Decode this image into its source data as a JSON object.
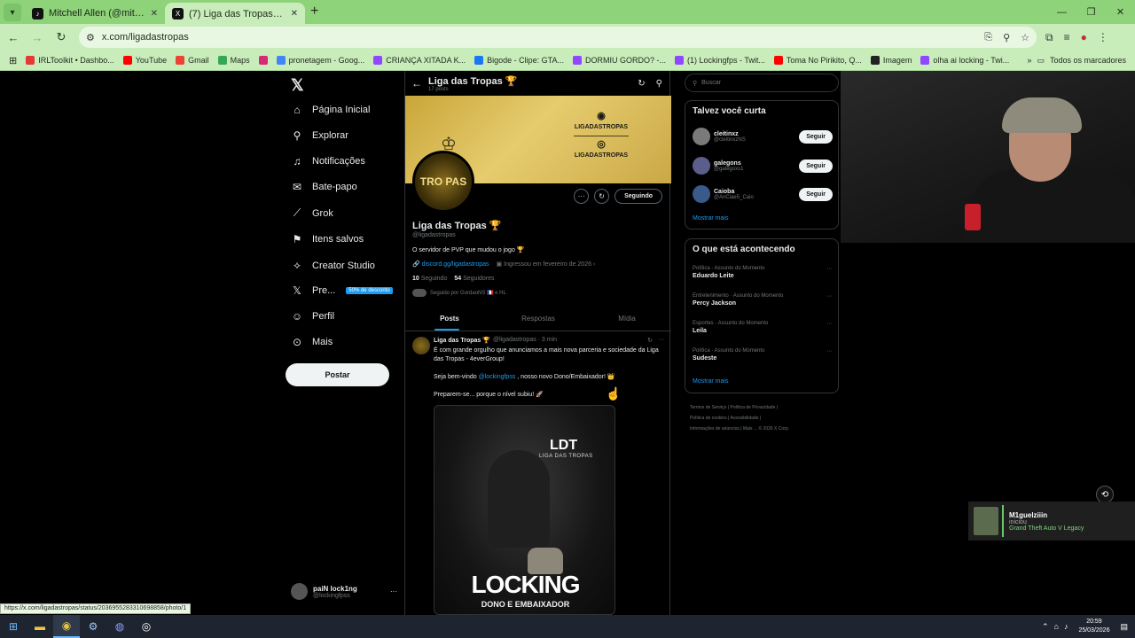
{
  "browser": {
    "tabs": [
      {
        "title": "Mitchell Allen (@mitchell.allen...",
        "icon": "tiktok-icon",
        "active": false
      },
      {
        "title": "(7) Liga das Tropas 🏆 (@ligada...",
        "icon": "x-icon",
        "active": true
      }
    ],
    "url": "x.com/ligadastropas",
    "bookmarks": [
      {
        "label": "IRLToolkit • Dashbo...",
        "color": "#e53935"
      },
      {
        "label": "YouTube",
        "color": "#ff0000"
      },
      {
        "label": "Gmail",
        "color": "#ea4335"
      },
      {
        "label": "Maps",
        "color": "#34a853"
      },
      {
        "label": "",
        "color": "#d62976"
      },
      {
        "label": "pronetagem - Goog...",
        "color": "#4285f4"
      },
      {
        "label": "CRIANÇA XITADA K...",
        "color": "#9146ff"
      },
      {
        "label": "Bigode - Clipe: GTA...",
        "color": "#1877f2"
      },
      {
        "label": "DORMIU GORDO? -...",
        "color": "#9146ff"
      },
      {
        "label": "(1) Lockingfps - Twit...",
        "color": "#9146ff"
      },
      {
        "label": "Toma No Pirikito, Q...",
        "color": "#ff0000"
      },
      {
        "label": "Imagem",
        "color": "#222222"
      },
      {
        "label": "olha ai locking - Twi...",
        "color": "#9146ff"
      }
    ],
    "all_bookmarks": "Todos os marcadores",
    "status_url": "https://x.com/ligadastropas/status/2036955283310698858/photo/1"
  },
  "nav": {
    "items": [
      {
        "label": "Página Inicial",
        "icon": "home-icon",
        "glyph": "⌂"
      },
      {
        "label": "Explorar",
        "icon": "search-icon",
        "glyph": "⚲"
      },
      {
        "label": "Notificações",
        "icon": "bell-icon",
        "glyph": "🔔"
      },
      {
        "label": "Bate-papo",
        "icon": "mail-icon",
        "glyph": "✉"
      },
      {
        "label": "Grok",
        "icon": "grok-icon",
        "glyph": "⟋"
      },
      {
        "label": "Itens salvos",
        "icon": "bookmark-icon",
        "glyph": "⚑"
      },
      {
        "label": "Creator Studio",
        "icon": "creator-icon",
        "glyph": "⟡"
      },
      {
        "label": "Pre...",
        "icon": "x-premium-icon",
        "glyph": "𝕏"
      },
      {
        "label": "Perfil",
        "icon": "profile-icon",
        "glyph": "☺"
      },
      {
        "label": "Mais",
        "icon": "more-icon",
        "glyph": "⋯"
      }
    ],
    "promo": "50% de desconto",
    "post_button": "Postar",
    "account_name": "paiN lock1ng",
    "account_handle": "@lockingfpss"
  },
  "profile": {
    "header_title": "Liga das Tropas 🏆",
    "post_count": "17 posts",
    "banner_discord": "LIGADASTROPAS",
    "banner_instagram": "LIGADASTROPAS",
    "avatar_text": "TRO PAS",
    "follow_state": "Seguindo",
    "name": "Liga das Tropas 🏆",
    "handle": "@ligadastropas",
    "bio": "O servidor de PVP que mudou o jogo 🏆",
    "link": "discord.gg/ligadastropas",
    "joined": "Ingressou em fevereiro de 2026",
    "following_count": "10",
    "following_label": "Seguindo",
    "followers_count": "54",
    "followers_label": "Seguidores",
    "followed_by": "Seguido por GordaoNS 🇫🇷 e HL",
    "tabs": [
      "Posts",
      "Respostas",
      "Mídia"
    ]
  },
  "tweet": {
    "name": "Liga das Tropas 🏆",
    "meta": "@ligadastropas · 3 min",
    "line1": "É com grande orgulho que anunciamos a mais nova parceria e sociedade da Liga das Tropas - 4everGroup!",
    "line2_pre": "Seja bem-vindo",
    "mention": "@lockingfpss",
    "line2_post": ", nosso novo Dono/Embaixador! 👑",
    "line3": "Preparem-se... porque o nível subiu! 🚀",
    "media_ldt": "LDT",
    "media_ldt_sub": "LIGA DAS TROPAS",
    "media_title": "LOCKING",
    "media_subtitle": "DONO E EMBAIXADOR"
  },
  "right": {
    "search_placeholder": "Buscar",
    "wtf_title": "Talvez você curta",
    "wtf": [
      {
        "name": "cleitinxz",
        "handle": "@cleitinxzNS",
        "button": "Seguir"
      },
      {
        "name": "galegons",
        "handle": "@galegoxs1",
        "button": "Seguir"
      },
      {
        "name": "Caioba",
        "handle": "@AnCiae5_Caio",
        "button": "Seguir"
      }
    ],
    "show_more": "Mostrar mais",
    "trends_title": "O que está acontecendo",
    "trends": [
      {
        "category": "Política · Assunto do Momento",
        "name": "Eduardo Leite"
      },
      {
        "category": "Entretenimento · Assunto do Momento",
        "name": "Percy Jackson"
      },
      {
        "category": "Esportes · Assunto do Momento",
        "name": "Leila"
      },
      {
        "category": "Política · Assunto do Momento",
        "name": "Sudeste"
      }
    ],
    "trends_more": "Mostrar mais",
    "footer": [
      "Termos de Serviço",
      "Política de Privacidade",
      "Política de cookies",
      "Acessibilidade",
      "Informações de anúncios",
      "Mais ...",
      "© 2026 X Corp."
    ]
  },
  "toast": {
    "name": "M1guelziiin",
    "status": "iniciou",
    "game": "Grand Theft Auto V Legacy"
  },
  "taskbar": {
    "time": "20:59",
    "date": "25/03/2026"
  }
}
